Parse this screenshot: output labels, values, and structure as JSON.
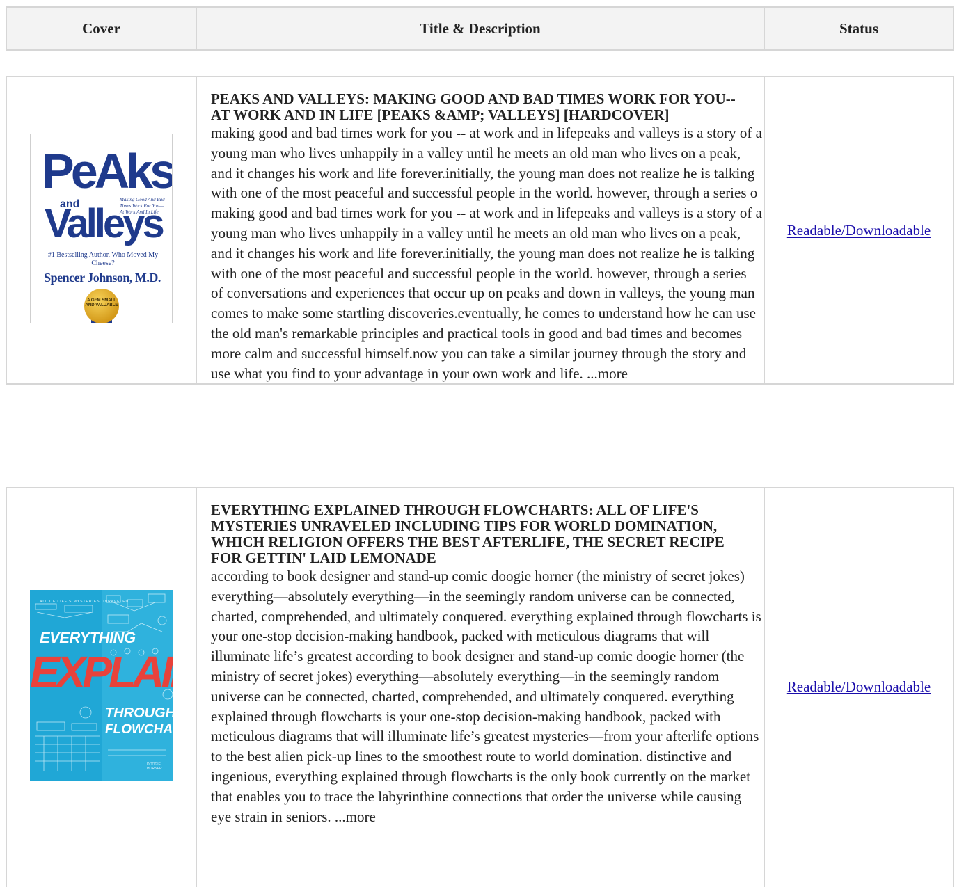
{
  "table": {
    "headers": {
      "cover": "Cover",
      "title_description": "Title & Description",
      "status": "Status"
    }
  },
  "books": [
    {
      "title": "PEAKS AND VALLEYS: MAKING GOOD AND BAD TIMES WORK FOR YOU--AT WORK AND IN LIFE   [PEAKS &AMP; VALLEYS] [HARDCOVER]",
      "description": "making good and bad times work for you -- at work and in lifepeaks and valleys is a story of a young man who lives unhappily in a valley until he meets an old man who lives on a peak, and it changes his work and life forever.initially, the young man does not realize he is talking with one of the most peaceful and successful people in the world. however, through a series o making good and bad times work for you -- at work and in lifepeaks and valleys is a story of a young man who lives unhappily in a valley until he meets an old man who lives on a peak, and it changes his work and life forever.initially, the young man does not realize he is talking with one of the most peaceful and successful people in the world. however, through a series of conversations and experiences that occur up on peaks and down in valleys, the young man comes to make some startling discoveries.eventually, he comes to understand how he can use the old man's remarkable principles and practical tools in good and bad times and becomes more calm and successful himself.now you can take a similar journey through the story and use what you find to your advantage in your own work and life. ...more",
      "status": "Readable/Downloadable",
      "cover": {
        "title_line1": "PeAks",
        "title_and": "and",
        "title_line2": "Valleys",
        "tagline": "Making Good And Bad Times Work For You— At Work And In Life",
        "author_note": "#1 Bestselling Author, Who Moved My Cheese?",
        "author": "Spencer Johnson, M.D.",
        "seal": "A GEM SMALL AND VALUABLE"
      }
    },
    {
      "title": "EVERYTHING EXPLAINED THROUGH FLOWCHARTS: ALL OF LIFE'S MYSTERIES UNRAVELED INCLUDING TIPS FOR WORLD DOMINATION, WHICH RELIGION OFFERS THE BEST AFTERLIFE, THE SECRET RECIPE FOR GETTIN' LAID LEMONADE",
      "description": "according to book designer and stand-up comic doogie horner (the ministry of secret jokes) everything—absolutely everything—in the seemingly random universe can be connected, charted, comprehended, and ultimately conquered. everything explained through flowcharts is your one-stop decision-making handbook, packed with meticulous diagrams that will illuminate life’s greatest according to book designer and stand-up comic doogie horner (the ministry of secret jokes) everything—absolutely everything—in the seemingly random universe can be connected, charted, comprehended, and ultimately conquered. everything explained through flowcharts is your one-stop decision-making handbook, packed with meticulous diagrams that will illuminate life’s greatest mysteries—from your afterlife options to the best alien pick-up lines to the smoothest route to world domination. distinctive and ingenious, everything explained through flowcharts is the only book currently on the market that enables you to trace the labyrinthine connections that order the universe while causing eye strain in seniors. ...more",
      "status": "Readable/Downloadable",
      "cover": {
        "top_line": "ALL OF LIFE'S MYSTERIES UNRAVELED",
        "word1": "EVERYTHING",
        "word2": "EXPLAINED",
        "word3": "THROUGH",
        "word4": "FLOWCHARTS",
        "author": "DOOGIE HORNER",
        "accent": "#e8423b",
        "background": "#20a7d6"
      }
    }
  ],
  "colors": {
    "link": "#1a0dab",
    "header_bg": "#f3f3f3",
    "border": "#d6d6d6"
  }
}
